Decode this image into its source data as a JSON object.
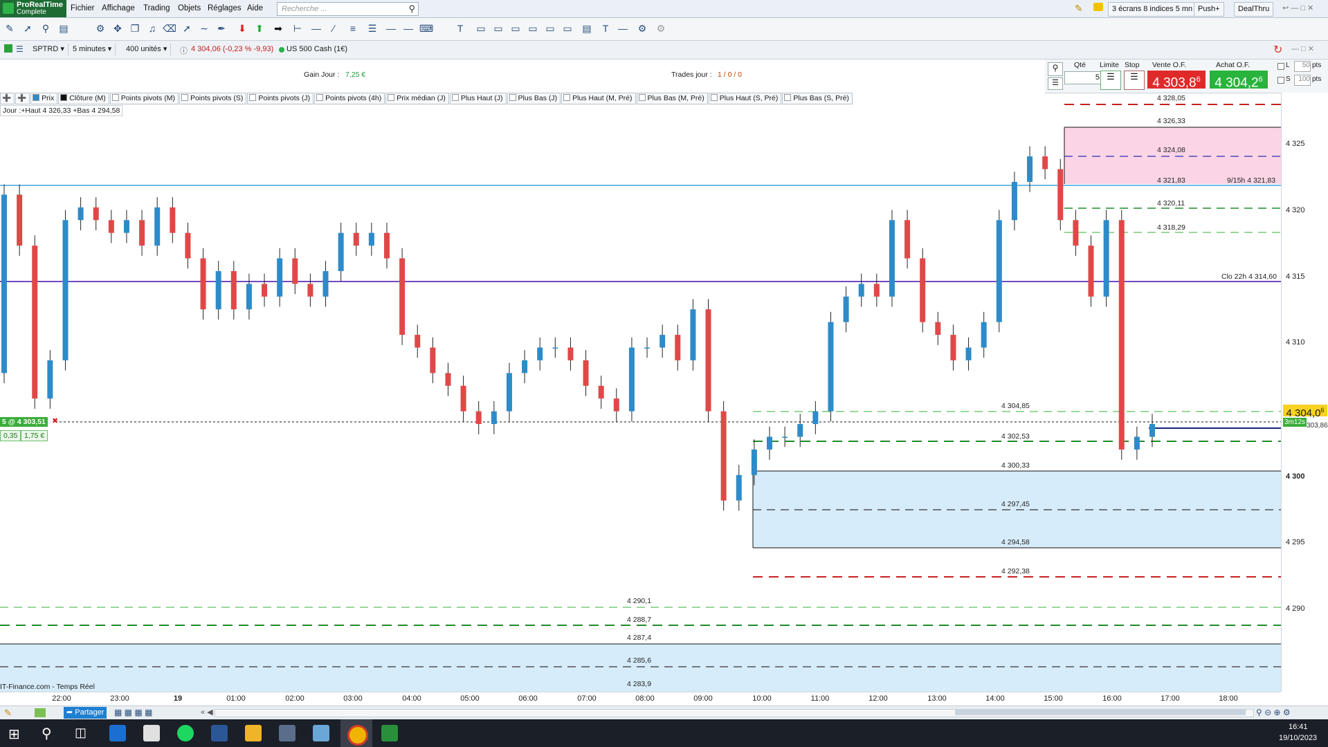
{
  "app": {
    "logo_line1": "ProRealTime",
    "logo_line2": "Complete"
  },
  "menu": [
    "Fichier",
    "Affichage",
    "Trading",
    "Objets",
    "Réglages",
    "Aide"
  ],
  "search": {
    "placeholder": "Recherche ..."
  },
  "top_right": {
    "layout": "3 écrans 8 indices 5 mn",
    "push": "Push+",
    "dealthru": "DealThru"
  },
  "chart_toolbar": {
    "instrument": "SPTRD",
    "timeframe": "5 minutes",
    "units": "400 unités",
    "quote": "4 304,06 (-0,23 % -9,93)",
    "name": "US 500 Cash (1€)"
  },
  "info": {
    "gain_label": "Gain Jour :",
    "gain_value": "7,25 €",
    "trades_label": "Trades jour :",
    "trades_value": "1 / 0 / 0"
  },
  "order_panel": {
    "qty_label": "Qté",
    "qty_value": "5",
    "limit_label": "Limite",
    "stop_label": "Stop",
    "sell_label": "Vente O.F.",
    "buy_label": "Achat O.F.",
    "sell_price": "4 303,8",
    "sell_sup": "6",
    "buy_price": "4 304,2",
    "buy_sup": "6",
    "l_label": "L",
    "l_value": "50",
    "s_label": "S",
    "s_value": "100",
    "pts": "pts"
  },
  "legend": [
    "Prix",
    "Clôture (M)",
    "Points pivots (M)",
    "Points pivots (S)",
    "Points pivots (J)",
    "Points pivots (4h)",
    "Prix médian (J)",
    "Plus Haut (J)",
    "Plus Bas (J)",
    "Plus Haut (M, Pré)",
    "Plus Bas (M, Pré)",
    "Plus Haut (S, Pré)",
    "Plus Bas (S, Pré)"
  ],
  "day_info": "Jour :+Haut 4 326,33 +Bas 4 294,58",
  "position": {
    "label": "5 @ 4 303,51",
    "pnl_pts": "0,35",
    "pnl_eur": "1,75 €"
  },
  "current_price": {
    "value": "4 304,0",
    "sup": "6",
    "countdown": "3m12s",
    "other": "303,86"
  },
  "price_axis": [
    "4 325",
    "4 320",
    "4 315",
    "4 310",
    "4 305",
    "4 300",
    "4 295",
    "4 290"
  ],
  "time_axis": [
    "22:00",
    "23:00",
    "19",
    "01:00",
    "02:00",
    "03:00",
    "04:00",
    "05:00",
    "06:00",
    "07:00",
    "08:00",
    "09:00",
    "10:00",
    "11:00",
    "12:00",
    "13:00",
    "14:00",
    "15:00",
    "16:00",
    "17:00",
    "18:00"
  ],
  "levels": {
    "upper": [
      "4 328,05",
      "4 326,33",
      "4 324,08",
      "4 321,83",
      "4 320,11",
      "4 318,29"
    ],
    "right_labels": [
      "9/15h 4 321,83",
      "Clo 22h 4 314,60"
    ],
    "mid": [
      "4 304,85",
      "4 302,53",
      "4 300,33",
      "4 297,45",
      "4 294,58",
      "4 292,38"
    ],
    "lower": [
      "4 290,1",
      "4 288,7",
      "4 287,4",
      "4 285,6",
      "4 283,9"
    ]
  },
  "footer_source": "IT-Finance.com - Temps Réel",
  "bottom": {
    "share": "Partager"
  },
  "clock": {
    "time": "16:41",
    "date": "19/10/2023"
  },
  "chart_data": {
    "type": "candlestick",
    "ylim": [
      4283,
      4330
    ],
    "x": [
      "21:45",
      "22:00",
      "22:15",
      "22:30",
      "22:45",
      "23:00",
      "23:15",
      "23:30",
      "23:45",
      "00:00",
      "00:15",
      "00:30",
      "00:45",
      "01:00",
      "01:15",
      "01:30",
      "01:45",
      "02:00",
      "02:15",
      "02:30",
      "02:45",
      "03:00",
      "03:15",
      "03:30",
      "03:45",
      "04:00",
      "04:15",
      "04:30",
      "04:45",
      "05:00",
      "05:15",
      "05:30",
      "05:45",
      "06:00",
      "06:15",
      "06:30",
      "06:45",
      "07:00",
      "07:15",
      "07:30",
      "07:45",
      "08:00",
      "08:15",
      "08:30",
      "08:45",
      "09:00",
      "09:15",
      "09:30",
      "09:45",
      "10:00",
      "10:15",
      "10:30",
      "10:45",
      "11:00",
      "11:15",
      "11:30",
      "11:45",
      "12:00",
      "12:15",
      "12:30",
      "12:45",
      "13:00",
      "13:15",
      "13:30",
      "13:45",
      "14:00",
      "14:15",
      "14:30",
      "14:45",
      "15:00",
      "15:15",
      "15:30",
      "15:45",
      "16:00",
      "16:15",
      "16:30",
      "16:35"
    ],
    "close": [
      4322,
      4318,
      4306,
      4309,
      4320,
      4321,
      4320,
      4319,
      4320,
      4318,
      4321,
      4319,
      4317,
      4313,
      4316,
      4313,
      4315,
      4314,
      4317,
      4315,
      4314,
      4316,
      4319,
      4318,
      4319,
      4317,
      4311,
      4310,
      4308,
      4307,
      4305,
      4304,
      4305,
      4308,
      4309,
      4310,
      4310,
      4309,
      4307,
      4306,
      4305,
      4310,
      4310,
      4311,
      4309,
      4313,
      4305,
      4298,
      4300,
      4302,
      4303,
      4303,
      4304,
      4305,
      4312,
      4314,
      4315,
      4314,
      4320,
      4317,
      4312,
      4311,
      4309,
      4310,
      4312,
      4320,
      4323,
      4325,
      4324,
      4320,
      4318,
      4314,
      4320,
      4302,
      4303,
      4304
    ],
    "open": [
      4308,
      4322,
      4318,
      4306,
      4309,
      4320,
      4321,
      4320,
      4319,
      4320,
      4318,
      4321,
      4319,
      4317,
      4313,
      4316,
      4313,
      4315,
      4314,
      4317,
      4315,
      4314,
      4316,
      4319,
      4318,
      4319,
      4317,
      4311,
      4310,
      4308,
      4307,
      4305,
      4304,
      4305,
      4308,
      4309,
      4310,
      4310,
      4309,
      4307,
      4306,
      4305,
      4310,
      4310,
      4311,
      4309,
      4313,
      4305,
      4298,
      4300,
      4302,
      4303,
      4303,
      4304,
      4305,
      4312,
      4314,
      4315,
      4314,
      4320,
      4317,
      4312,
      4311,
      4309,
      4310,
      4312,
      4320,
      4323,
      4325,
      4324,
      4320,
      4318,
      4314,
      4320,
      4302,
      4303
    ],
    "levels": [
      4328.05,
      4326.33,
      4324.08,
      4321.83,
      4320.11,
      4318.29,
      4314.6,
      4304.85,
      4302.53,
      4300.33,
      4297.45,
      4294.58,
      4292.38,
      4290.1,
      4288.7,
      4287.4,
      4285.6,
      4283.9
    ],
    "colors": {
      "up": "#2e8bc9",
      "down": "#e04848"
    }
  }
}
